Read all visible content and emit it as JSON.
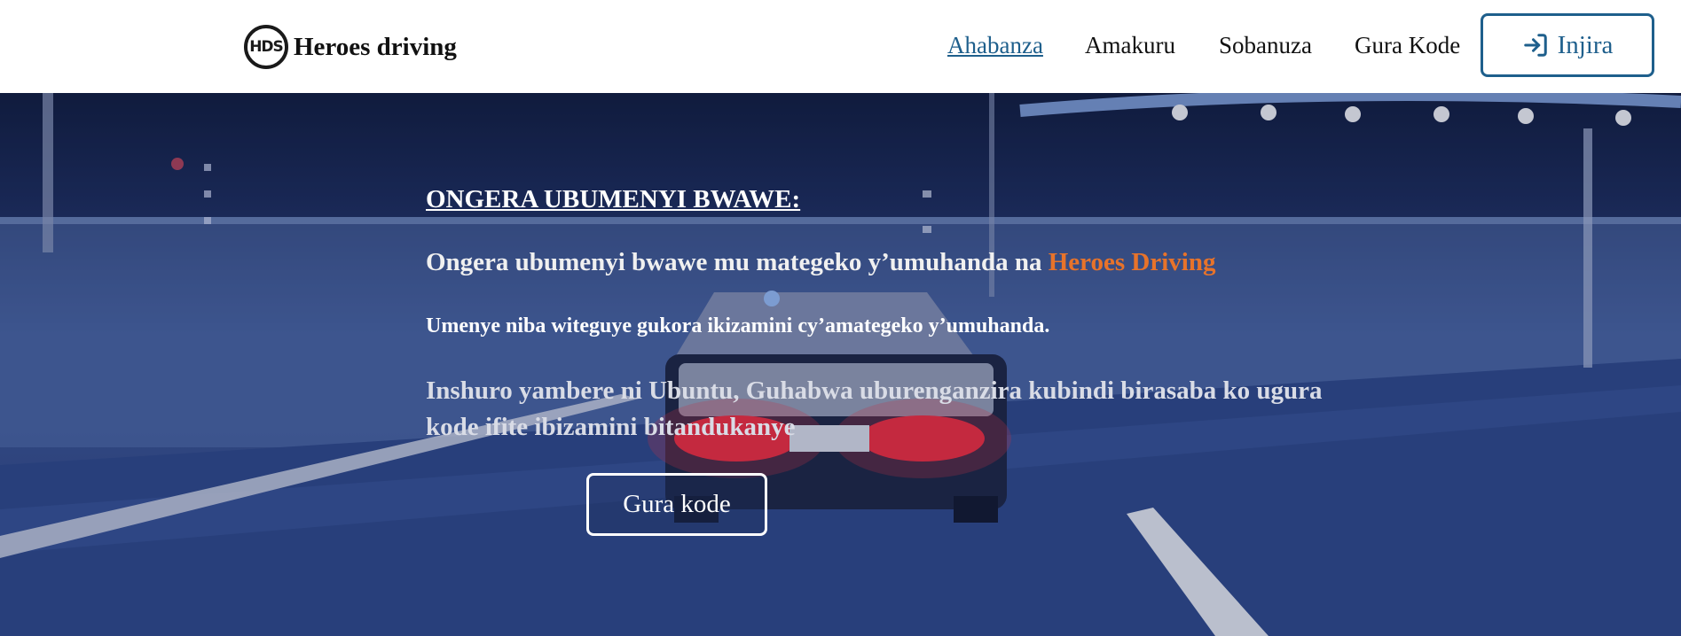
{
  "header": {
    "logo_text": "HDS",
    "brand_name": "Heroes driving",
    "nav": [
      {
        "label": "Ahabanza",
        "active": true
      },
      {
        "label": "Amakuru",
        "active": false
      },
      {
        "label": "Sobanuza",
        "active": false
      },
      {
        "label": "Gura Kode",
        "active": false
      }
    ],
    "login_label": "Injira",
    "login_icon": "sign-in-icon",
    "accent_color": "#1e5f8c"
  },
  "hero": {
    "heading": "ONGERA UBUMENYI BWAWE:",
    "subtitle_prefix": "Ongera ubumenyi bwawe mu mategeko y’umuhanda na ",
    "subtitle_brand": "Heroes Driving",
    "note": "Umenye niba witeguye gukora ikizamini cy’amategeko y’umuhanda.",
    "description": "Inshuro yambere ni Ubuntu, Guhabwa uburenganzira kubindi birasaba ko ugura kode ifite ibizamini bitandukanye",
    "cta_label": "Gura kode",
    "brand_accent_color": "#e8732a"
  }
}
